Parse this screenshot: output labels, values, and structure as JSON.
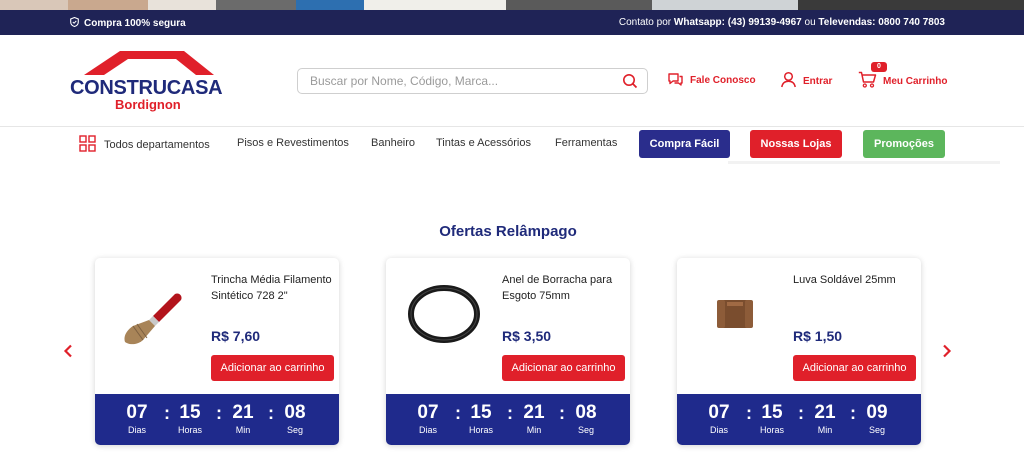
{
  "colors": {
    "navy": "#1f2356",
    "brand_blue": "#1f2a7a",
    "brand_red": "#e0202a",
    "compra_facil": "#2a2d8c",
    "nossas_lojas": "#e0202a",
    "promocoes": "#5cb65c",
    "timer_bg": "#1f2a8c"
  },
  "topbar": {
    "secure_label": "Compra 100% segura",
    "contact_prefix": "Contato por ",
    "whatsapp_label": "Whatsapp: (43) 99139-4967",
    "contact_mid": " ou ",
    "televendas_label": "Televendas: 0800 740 7803"
  },
  "logo": {
    "name": "CONSTRUCASA",
    "sub": "Bordignon"
  },
  "search": {
    "placeholder": "Buscar por Nome, Código, Marca..."
  },
  "header_links": {
    "contact": "Fale Conosco",
    "login": "Entrar",
    "cart": "Meu Carrinho",
    "cart_count": "0"
  },
  "nav": {
    "departments": "Todos departamentos",
    "items": [
      "Pisos e Revestimentos",
      "Banheiro",
      "Tintas e Acessórios",
      "Ferramentas"
    ],
    "buttons": [
      "Compra Fácil",
      "Nossas Lojas",
      "Promoções"
    ]
  },
  "section": {
    "title": "Ofertas Relâmpago"
  },
  "products": [
    {
      "name": "Trincha Média Filamento Sintético 728 2\"",
      "price": "R$ 7,60",
      "button": "Adicionar ao carrinho",
      "image": "paint-brush-icon",
      "timer": {
        "days": "07",
        "hours": "15",
        "minutes": "21",
        "seconds": "08"
      }
    },
    {
      "name": "Anel de Borracha para Esgoto 75mm",
      "price": "R$ 3,50",
      "button": "Adicionar ao carrinho",
      "image": "rubber-ring-icon",
      "timer": {
        "days": "07",
        "hours": "15",
        "minutes": "21",
        "seconds": "08"
      }
    },
    {
      "name": "Luva Soldável 25mm",
      "price": "R$ 1,50",
      "button": "Adicionar ao carrinho",
      "image": "pipe-coupling-icon",
      "timer": {
        "days": "07",
        "hours": "15",
        "minutes": "21",
        "seconds": "09"
      }
    }
  ],
  "timer_labels": {
    "days": "Dias",
    "hours": "Horas",
    "minutes": "Min",
    "seconds": "Seg"
  },
  "timer_separator": ":"
}
